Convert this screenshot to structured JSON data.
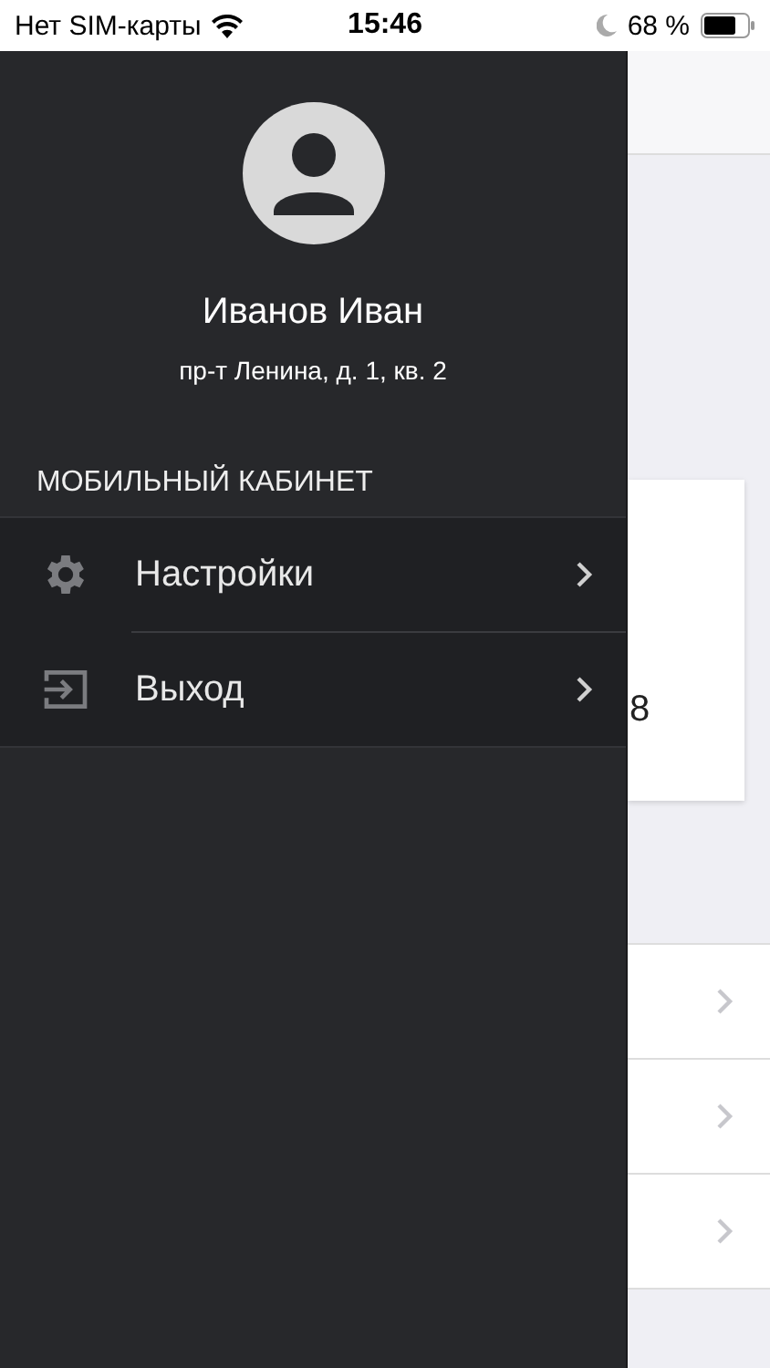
{
  "status_bar": {
    "carrier": "Нет SIM-карты",
    "time": "15:46",
    "battery": "68 %"
  },
  "drawer": {
    "user_name": "Иванов Иван",
    "address": "пр-т Ленина, д. 1, кв. 2",
    "section_title": "МОБИЛЬНЫЙ КАБИНЕТ",
    "items": [
      {
        "kind": "settings",
        "label": "Настройки"
      },
      {
        "kind": "logout",
        "label": "Выход"
      }
    ]
  },
  "background": {
    "card": {
      "text": "8"
    },
    "rows": [
      {
        "kind": "link"
      },
      {
        "kind": "link"
      },
      {
        "kind": "link"
      }
    ]
  }
}
